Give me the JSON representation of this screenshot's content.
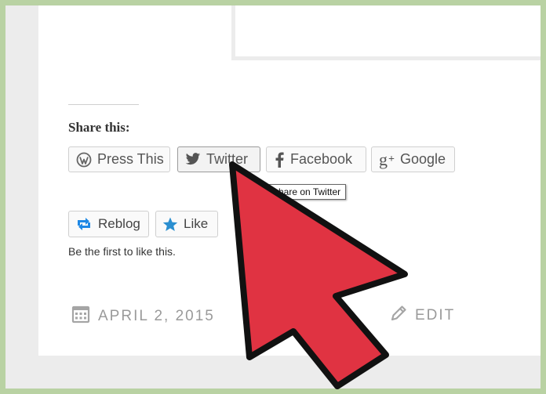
{
  "share": {
    "heading": "Share this:",
    "buttons": [
      {
        "label": "Press This",
        "icon": "wordpress-icon"
      },
      {
        "label": "Twitter",
        "icon": "twitter-bird-icon"
      },
      {
        "label": "Facebook",
        "icon": "facebook-icon"
      },
      {
        "label": "Google",
        "icon": "google-plus-icon"
      }
    ],
    "tooltip": "share on Twitter"
  },
  "reactions": {
    "reblog_label": "Reblog",
    "like_label": "Like",
    "like_note": "Be the first to like this."
  },
  "meta": {
    "date": "APRIL 2, 2015",
    "edit_label": "EDIT"
  },
  "colors": {
    "outer_border": "#b9d2a3",
    "page_background": "#ececec",
    "reblog_icon": "#1e88e5",
    "like_star": "#2b8fd0",
    "arrow_fill": "#e03342",
    "arrow_outline": "#111111"
  }
}
